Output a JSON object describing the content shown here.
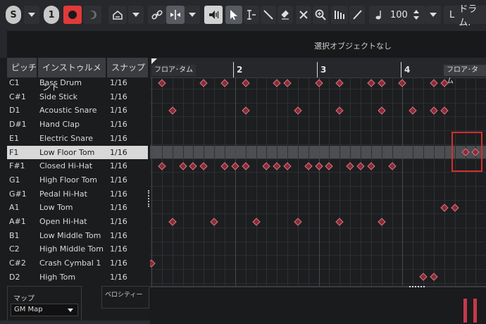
{
  "toolbar": {
    "solo_label": "S",
    "one_label": "1",
    "velocity_value": "100",
    "drum_map_prefix": "L",
    "drum_map_label": "ドラム."
  },
  "infoline": {
    "text": "選択オブジェクトなし"
  },
  "columns": {
    "pitch": "ピッチ",
    "instrument": "インストゥルメント",
    "snap": "スナップ"
  },
  "instruments": [
    {
      "pitch": "C1",
      "name": "Bass Drum",
      "snap": "1/16"
    },
    {
      "pitch": "C#1",
      "name": "Side Stick",
      "snap": "1/16"
    },
    {
      "pitch": "D1",
      "name": "Acoustic Snare",
      "snap": "1/16"
    },
    {
      "pitch": "D#1",
      "name": "Hand Clap",
      "snap": "1/16"
    },
    {
      "pitch": "E1",
      "name": "Electric Snare",
      "snap": "1/16"
    },
    {
      "pitch": "F1",
      "name": "Low Floor Tom",
      "snap": "1/16"
    },
    {
      "pitch": "F#1",
      "name": "Closed Hi-Hat",
      "snap": "1/16"
    },
    {
      "pitch": "G1",
      "name": "High Floor Tom",
      "snap": "1/16"
    },
    {
      "pitch": "G#1",
      "name": "Pedal Hi-Hat",
      "snap": "1/16"
    },
    {
      "pitch": "A1",
      "name": "Low Tom",
      "snap": "1/16"
    },
    {
      "pitch": "A#1",
      "name": "Open Hi-Hat",
      "snap": "1/16"
    },
    {
      "pitch": "B1",
      "name": "Low Middle Tom",
      "snap": "1/16"
    },
    {
      "pitch": "C2",
      "name": "High Middle Tom",
      "snap": "1/16"
    },
    {
      "pitch": "C#2",
      "name": "Crash Cymbal 1",
      "snap": "1/16"
    },
    {
      "pitch": "D2",
      "name": "High Tom",
      "snap": "1/16"
    }
  ],
  "selected_instrument": "Low Floor Tom",
  "map": {
    "label": "マップ",
    "value": "GM Map"
  },
  "velocity_lane_label": "ベロシティー",
  "ruler": {
    "left_label": "フロア･タム",
    "right_label": "フロア･タム",
    "bars": [
      "2",
      "3",
      "4"
    ]
  },
  "notes": [
    [
      1,
      5,
      7,
      9,
      12,
      13,
      16,
      18,
      21,
      22,
      24,
      27,
      28
    ],
    [],
    [
      2,
      9,
      14,
      18,
      22,
      25,
      27,
      28
    ],
    [],
    [],
    [
      30,
      31
    ],
    [
      1,
      3,
      4,
      5,
      7,
      8,
      9,
      11,
      12,
      13,
      15,
      16,
      17,
      19,
      20,
      21,
      23
    ],
    [],
    [],
    [
      28,
      29
    ],
    [
      2,
      6,
      10,
      14,
      18,
      22
    ],
    [],
    [],
    [
      0
    ],
    [
      26,
      27
    ]
  ],
  "colors": {
    "note_fill": "#8d2a37",
    "selection_box": "#d32f2f",
    "record": "#d93a3a",
    "selected_row": "#d8d8d8"
  }
}
